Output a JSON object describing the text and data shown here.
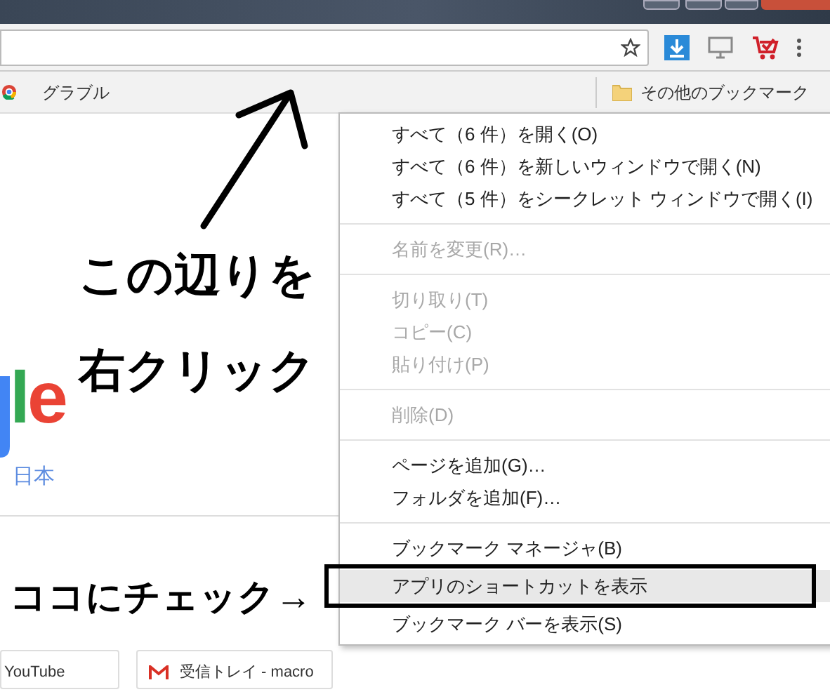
{
  "bookmarks_bar": {
    "items": [
      {
        "label": "グラブル"
      }
    ],
    "other_bookmarks": "その他のブックマーク"
  },
  "page": {
    "logo": [
      {
        "char": "l",
        "color": "#34a853"
      },
      {
        "char": "e",
        "color": "#ea4335"
      }
    ],
    "region": "日本",
    "tiles": [
      {
        "label": "YouTube",
        "kind": "plain"
      },
      {
        "label": "受信トレイ - macro",
        "kind": "mail"
      }
    ]
  },
  "context_menu": {
    "items": [
      {
        "kind": "item",
        "label": "すべて（6 件）を開く(O)",
        "disabled": false,
        "selected": false
      },
      {
        "kind": "item",
        "label": "すべて（6 件）を新しいウィンドウで開く(N)",
        "disabled": false,
        "selected": false
      },
      {
        "kind": "item",
        "label": "すべて（5 件）をシークレット ウィンドウで開く(I)",
        "disabled": false,
        "selected": false
      },
      {
        "kind": "separator"
      },
      {
        "kind": "item",
        "label": "名前を変更(R)…",
        "disabled": true,
        "selected": false
      },
      {
        "kind": "separator"
      },
      {
        "kind": "item",
        "label": "切り取り(T)",
        "disabled": true,
        "selected": false
      },
      {
        "kind": "item",
        "label": "コピー(C)",
        "disabled": true,
        "selected": false
      },
      {
        "kind": "item",
        "label": "貼り付け(P)",
        "disabled": true,
        "selected": false
      },
      {
        "kind": "separator"
      },
      {
        "kind": "item",
        "label": "削除(D)",
        "disabled": true,
        "selected": false
      },
      {
        "kind": "separator"
      },
      {
        "kind": "item",
        "label": "ページを追加(G)…",
        "disabled": false,
        "selected": false
      },
      {
        "kind": "item",
        "label": "フォルダを追加(F)…",
        "disabled": false,
        "selected": false
      },
      {
        "kind": "separator"
      },
      {
        "kind": "item",
        "label": "ブックマーク マネージャ(B)",
        "disabled": false,
        "selected": false
      },
      {
        "kind": "item",
        "label": "アプリのショートカットを表示",
        "disabled": false,
        "selected": true
      },
      {
        "kind": "item",
        "label": "ブックマーク バーを表示(S)",
        "disabled": false,
        "selected": false
      }
    ]
  },
  "annotations": {
    "instruction_lines": [
      "この辺りを",
      "右クリック"
    ],
    "check_label": "ココにチェック→"
  }
}
